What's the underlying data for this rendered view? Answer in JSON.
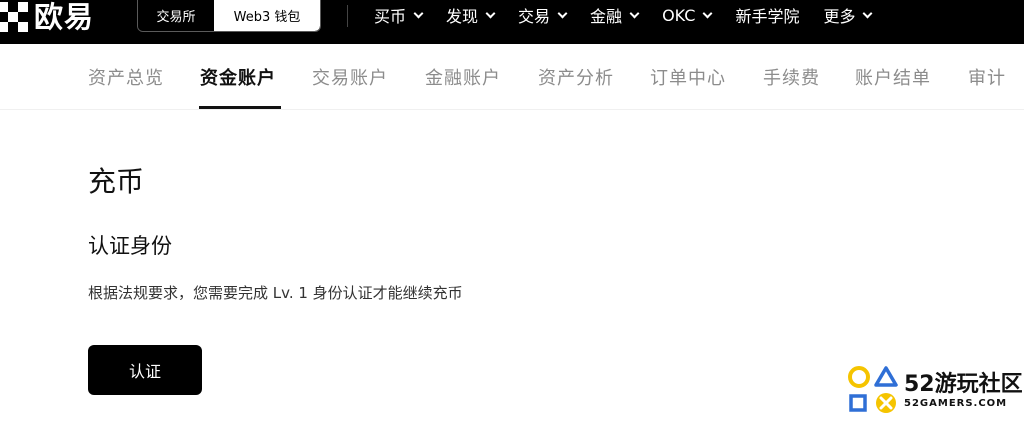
{
  "brand": {
    "name": "欧易"
  },
  "mode_switch": {
    "left": "交易所",
    "right": "Web3 钱包"
  },
  "nav": [
    {
      "label": "买币",
      "dropdown": true
    },
    {
      "label": "发现",
      "dropdown": true
    },
    {
      "label": "交易",
      "dropdown": true
    },
    {
      "label": "金融",
      "dropdown": true
    },
    {
      "label": "OKC",
      "dropdown": true
    },
    {
      "label": "新手学院",
      "dropdown": false
    },
    {
      "label": "更多",
      "dropdown": true
    }
  ],
  "tabs": [
    {
      "label": "资产总览",
      "active": false
    },
    {
      "label": "资金账户",
      "active": true
    },
    {
      "label": "交易账户",
      "active": false
    },
    {
      "label": "金融账户",
      "active": false
    },
    {
      "label": "资产分析",
      "active": false
    },
    {
      "label": "订单中心",
      "active": false
    },
    {
      "label": "手续费",
      "active": false
    },
    {
      "label": "账户结单",
      "active": false
    },
    {
      "label": "审计",
      "active": false
    }
  ],
  "content": {
    "title": "充币",
    "section_title": "认证身份",
    "description": "根据法规要求，您需要完成 Lv. 1 身份认证才能继续充币",
    "button_label": "认证"
  },
  "watermark": {
    "name": "52游玩社区",
    "domain": "52GAMERS.COM"
  },
  "colors": {
    "topbar": "#000000",
    "accent": "#000000",
    "tab_inactive": "#8c8c8c",
    "watermark_yellow": "#f5c400",
    "watermark_blue": "#2f6fd6"
  }
}
